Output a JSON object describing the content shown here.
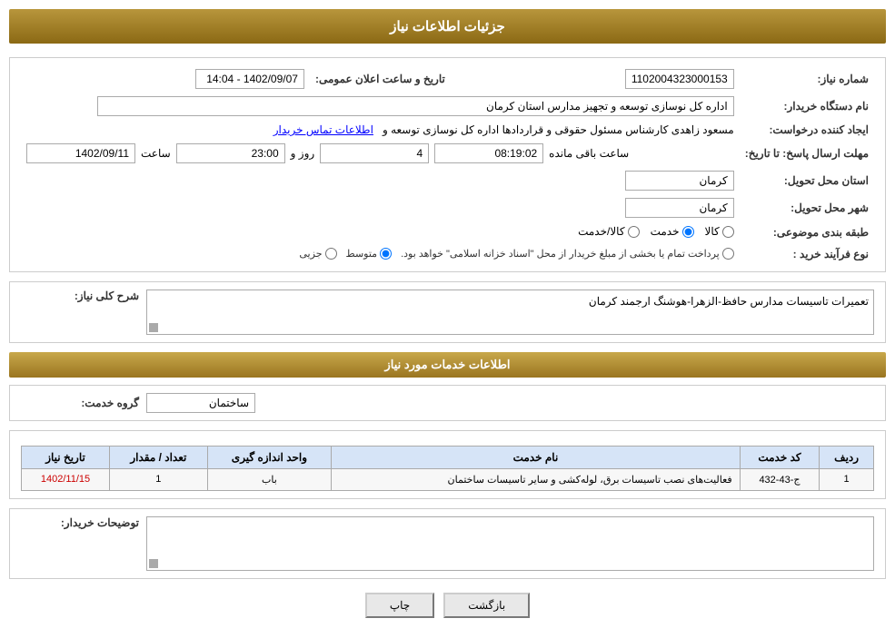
{
  "page": {
    "title": "جزئیات اطلاعات نیاز",
    "header": {
      "label": "جزئیات اطلاعات نیاز"
    }
  },
  "fields": {
    "need_number_label": "شماره نیاز:",
    "need_number_value": "1102004323000153",
    "announce_datetime_label": "تاریخ و ساعت اعلان عمومی:",
    "announce_datetime_value": "1402/09/07 - 14:04",
    "buyer_org_label": "نام دستگاه خریدار:",
    "buyer_org_value": "اداره کل نوسازی  توسعه و تجهیز مدارس استان کرمان",
    "creator_label": "ایجاد کننده درخواست:",
    "creator_value": "مسعود زاهدی کارشناس مسئول حقوقی و قراردادها اداره کل نوسازی  توسعه و",
    "creator_link": "اطلاعات تماس خریدار",
    "response_deadline_label": "مهلت ارسال پاسخ: تا تاریخ:",
    "response_date": "1402/09/11",
    "response_time_label": "ساعت",
    "response_time": "23:00",
    "remaining_days_label": "روز و",
    "remaining_days": "4",
    "remaining_time_label": "ساعت باقی مانده",
    "remaining_time": "08:19:02",
    "province_label": "استان محل تحویل:",
    "province_value": "کرمان",
    "city_label": "شهر محل تحویل:",
    "city_value": "کرمان",
    "subject_label": "طبقه بندی موضوعی:",
    "subject_options": [
      {
        "label": "کالا",
        "value": "kala"
      },
      {
        "label": "خدمت",
        "value": "khedmat"
      },
      {
        "label": "کالا/خدمت",
        "value": "kala_khedmat"
      }
    ],
    "subject_selected": "khedmat",
    "purchase_type_label": "نوع فرآیند خرید :",
    "purchase_type_options": [
      {
        "label": "جزیی",
        "value": "jozii"
      },
      {
        "label": "متوسط",
        "value": "motavasset"
      },
      {
        "label": "پرداخت تمام یا بخشی از مبلغ خریدار از محل \"اسناد خزانه اسلامی\" خواهد بود.",
        "value": "esnad"
      }
    ],
    "purchase_type_selected": "motavasset",
    "need_description_label": "شرح کلی نیاز:",
    "need_description_value": "تعمیرات تاسیسات مدارس حافظ-الزهرا-هوشنگ ارجمند کرمان",
    "services_section_title": "اطلاعات خدمات مورد نیاز",
    "service_group_label": "گروه خدمت:",
    "service_group_value": "ساختمان",
    "table": {
      "headers": [
        "ردیف",
        "کد خدمت",
        "نام خدمت",
        "واحد اندازه گیری",
        "تعداد / مقدار",
        "تاریخ نیاز"
      ],
      "rows": [
        {
          "row_num": "1",
          "code": "ج-43-432",
          "name": "فعالیت‌های نصب تاسیسات برق، لوله‌کشی و سایر تاسیسات ساختمان",
          "unit": "باب",
          "qty": "1",
          "date": "1402/11/15"
        }
      ]
    },
    "buyer_desc_label": "توضیحات خریدار:",
    "buyer_desc_value": "",
    "buttons": {
      "print_label": "چاپ",
      "back_label": "بازگشت"
    }
  }
}
